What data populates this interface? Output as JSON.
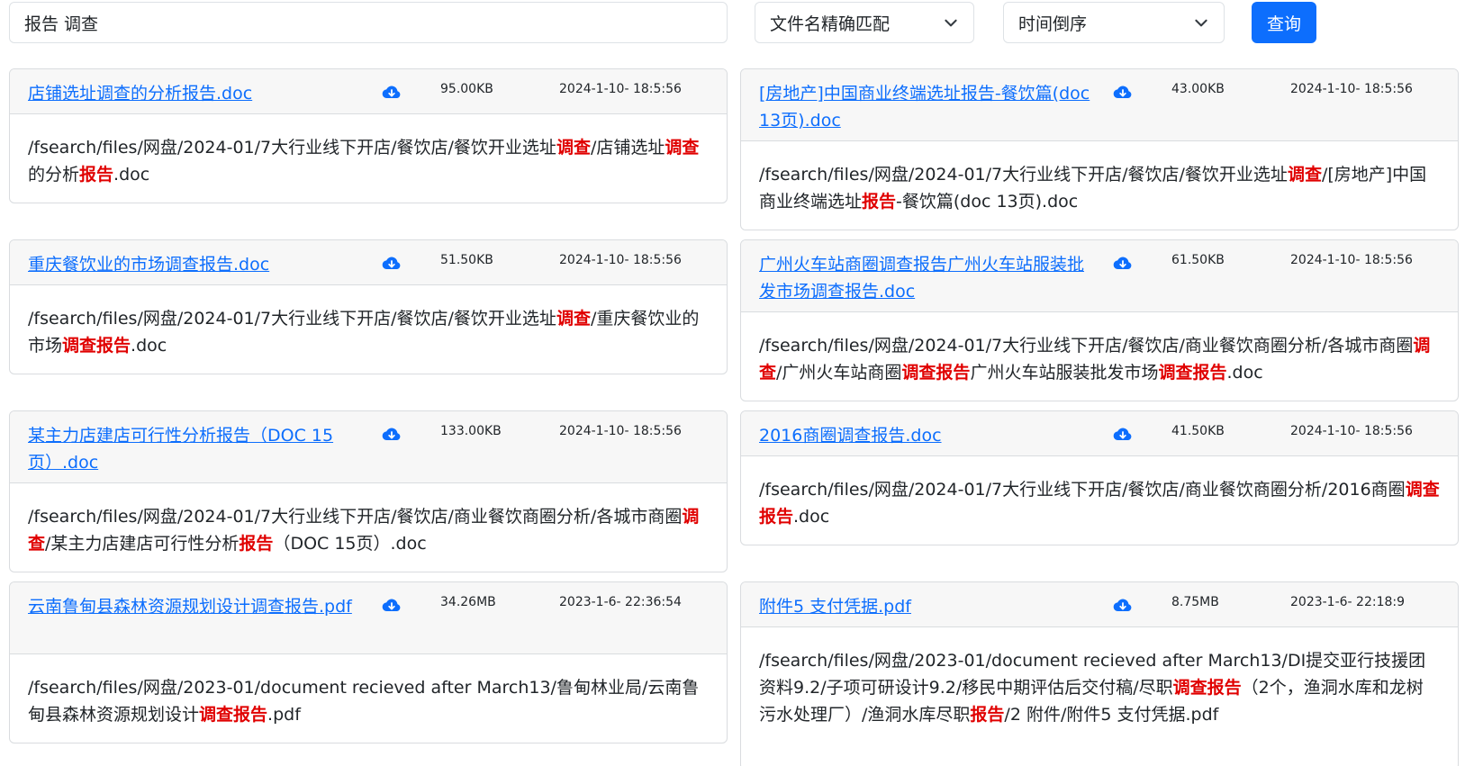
{
  "search": {
    "query": "报告 调查",
    "match_mode": "文件名精确匹配",
    "sort_mode": "时间倒序",
    "query_button": "查询"
  },
  "results": [
    {
      "title": "店铺选址调查的分析报告.doc",
      "size": "95.00KB",
      "time": "2024-1-10- 18:5:56",
      "path": [
        {
          "t": "/fsearch/files/网盘/2024-01/7大行业线下开店/餐饮店/餐饮开业选址",
          "h": false
        },
        {
          "t": "调查",
          "h": true
        },
        {
          "t": "/店铺选址",
          "h": false
        },
        {
          "t": "调查",
          "h": true
        },
        {
          "t": "的分析",
          "h": false
        },
        {
          "t": "报告",
          "h": true
        },
        {
          "t": ".doc",
          "h": false
        }
      ]
    },
    {
      "title": "[房地产]中国商业终端选址报告-餐饮篇(doc 13页).doc",
      "size": "43.00KB",
      "time": "2024-1-10- 18:5:56",
      "path": [
        {
          "t": "/fsearch/files/网盘/2024-01/7大行业线下开店/餐饮店/餐饮开业选址",
          "h": false
        },
        {
          "t": "调查",
          "h": true
        },
        {
          "t": "/[房地产]中国商业终端选址",
          "h": false
        },
        {
          "t": "报告",
          "h": true
        },
        {
          "t": "-餐饮篇(doc 13页).doc",
          "h": false
        }
      ]
    },
    {
      "title": "重庆餐饮业的市场调查报告.doc",
      "size": "51.50KB",
      "time": "2024-1-10- 18:5:56",
      "path": [
        {
          "t": "/fsearch/files/网盘/2024-01/7大行业线下开店/餐饮店/餐饮开业选址",
          "h": false
        },
        {
          "t": "调查",
          "h": true
        },
        {
          "t": "/重庆餐饮业的市场",
          "h": false
        },
        {
          "t": "调查报告",
          "h": true
        },
        {
          "t": ".doc",
          "h": false
        }
      ]
    },
    {
      "title": "广州火车站商圈调查报告广州火车站服装批发市场调查报告.doc",
      "size": "61.50KB",
      "time": "2024-1-10- 18:5:56",
      "path": [
        {
          "t": "/fsearch/files/网盘/2024-01/7大行业线下开店/餐饮店/商业餐饮商圈分析/各城市商圈",
          "h": false
        },
        {
          "t": "调查",
          "h": true
        },
        {
          "t": "/广州火车站商圈",
          "h": false
        },
        {
          "t": "调查报告",
          "h": true
        },
        {
          "t": "广州火车站服装批发市场",
          "h": false
        },
        {
          "t": "调查报告",
          "h": true
        },
        {
          "t": ".doc",
          "h": false
        }
      ]
    },
    {
      "title": "某主力店建店可行性分析报告（DOC 15页）.doc",
      "size": "133.00KB",
      "time": "2024-1-10- 18:5:56",
      "path": [
        {
          "t": "/fsearch/files/网盘/2024-01/7大行业线下开店/餐饮店/商业餐饮商圈分析/各城市商圈",
          "h": false
        },
        {
          "t": "调查",
          "h": true
        },
        {
          "t": "/某主力店建店可行性分析",
          "h": false
        },
        {
          "t": "报告",
          "h": true
        },
        {
          "t": "（DOC 15页）.doc",
          "h": false
        }
      ]
    },
    {
      "title": "2016商圈调查报告.doc",
      "size": "41.50KB",
      "time": "2024-1-10- 18:5:56",
      "path": [
        {
          "t": "/fsearch/files/网盘/2024-01/7大行业线下开店/餐饮店/商业餐饮商圈分析/2016商圈",
          "h": false
        },
        {
          "t": "调查报告",
          "h": true
        },
        {
          "t": ".doc",
          "h": false
        }
      ]
    },
    {
      "title": "云南鲁甸县森林资源规划设计调查报告.pdf",
      "size": "34.26MB",
      "time": "2023-1-6- 22:36:54",
      "path": [
        {
          "t": "/fsearch/files/网盘/2023-01/document recieved after March13/鲁甸林业局/云南鲁甸县森林资源规划设计",
          "h": false
        },
        {
          "t": "调查报告",
          "h": true
        },
        {
          "t": ".pdf",
          "h": false
        }
      ]
    },
    {
      "title": "附件5 支付凭据.pdf",
      "size": "8.75MB",
      "time": "2023-1-6- 22:18:9",
      "path": [
        {
          "t": "/fsearch/files/网盘/2023-01/document recieved after March13/DI提交亚行技援团资料9.2/子项可研设计9.2/移民中期评估后交付稿/尽职",
          "h": false
        },
        {
          "t": "调查报告",
          "h": true
        },
        {
          "t": "（2个，渔洞水库和龙树污水处理厂）/渔洞水库尽职",
          "h": false
        },
        {
          "t": "报告",
          "h": true
        },
        {
          "t": "/2 附件/附件5 支付凭据.pdf",
          "h": false
        }
      ]
    }
  ]
}
